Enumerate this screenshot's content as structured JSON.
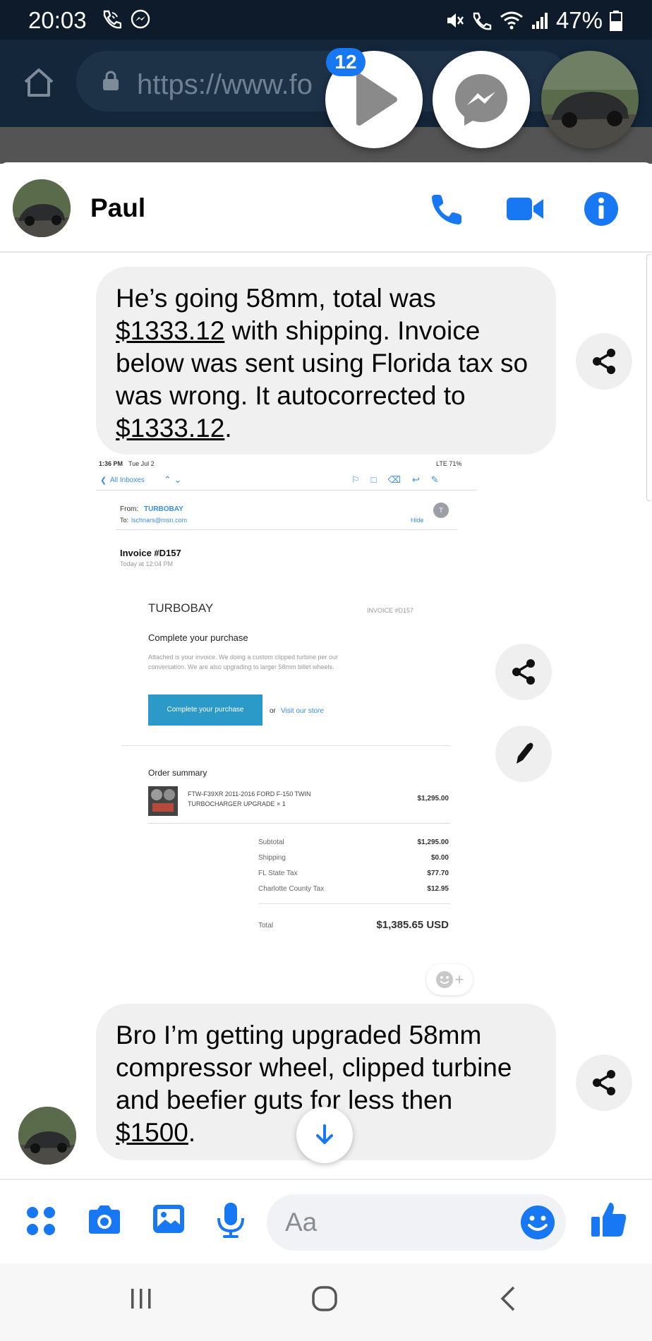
{
  "status_bar": {
    "time": "20:03",
    "battery": "47%",
    "icons": [
      "wifi-call-icon",
      "messenger-notification-icon",
      "mute-icon",
      "volte-icon",
      "wifi-icon",
      "signal-icon",
      "battery-icon"
    ]
  },
  "browser": {
    "url": "https://www.fo"
  },
  "chat_heads": {
    "badge_count": "12"
  },
  "header": {
    "contact_name": "Paul"
  },
  "messages": {
    "first": {
      "part1": "He’s going 58mm, total was ",
      "amount1": "$1333.12",
      "part2": " with shipping. Invoice below was sent using Florida tax so was wrong. It autocorrected to ",
      "amount2": "$1333.12",
      "part3": "."
    },
    "second": {
      "part1": "Bro I’m getting upgraded 58mm compressor wheel, clipped turbine and beefier guts for less then ",
      "amount": "$1500",
      "part2": "."
    }
  },
  "invoice": {
    "status_time": "1:36 PM",
    "status_date": "Tue Jul 2",
    "status_right": "LTE 71%",
    "back_label": "All Inboxes",
    "from_label": "From:",
    "from_value": "TURBOBAY",
    "to_label": "To:",
    "to_value": "lschnars@msn.com",
    "hide": "Hide",
    "sender_initial": "T",
    "subject": "Invoice #D157",
    "received": "Today at 12:04 PM",
    "brand": "TURBOBAY",
    "invoice_no": "INVOICE #D157",
    "heading": "Complete your purchase",
    "body_line1": "Attached is your invoice. We doing a custom clipped turbine per our",
    "body_line2": "conversation. We are also upgrading to larger 58mm billet wheels.",
    "button": "Complete your purchase",
    "or": "or",
    "visit_store": "Visit our store",
    "order_summary": "Order summary",
    "item_line1": "FTW-F39XR 2011-2016 FORD F-150 TWIN",
    "item_line2": "TURBOCHARGER UPGRADE × 1",
    "item_price": "$1,295.00",
    "subtotal_label": "Subtotal",
    "subtotal": "$1,295.00",
    "shipping_label": "Shipping",
    "shipping": "$0.00",
    "state_tax_label": "FL State Tax",
    "state_tax": "$77.70",
    "county_tax_label": "Charlotte County Tax",
    "county_tax": "$12.95",
    "total_label": "Total",
    "total": "$1,385.65 USD"
  },
  "composer": {
    "placeholder": "Aa"
  },
  "colors": {
    "messenger_blue": "#1877f2",
    "bubble_gray": "#f0f0f0",
    "status_dark": "#0d1b2a"
  }
}
